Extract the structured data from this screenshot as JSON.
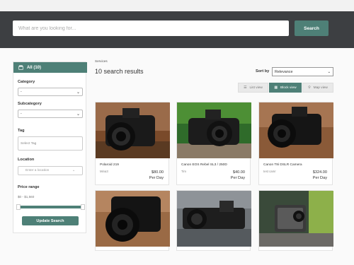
{
  "header": {
    "search_placeholder": "What are you looking for...",
    "search_label": "Search"
  },
  "sidebar": {
    "all_label": "All (10)",
    "category_label": "Category",
    "category_value": "-",
    "subcategory_label": "Subcategory",
    "subcategory_value": "-",
    "tag_label": "Tag",
    "tag_placeholder": "Select Tag",
    "location_label": "Location",
    "location_placeholder": "Enter a location",
    "price_label": "Price range",
    "price_value": "$0 - $1,560",
    "price_fill": 1.0,
    "update_label": "Update Search"
  },
  "main": {
    "breadcrumb": "Services",
    "results_title": "10 search results",
    "sort_label": "Sort by",
    "sort_value": "Relevance",
    "views": {
      "list": "List view",
      "block": "Block view",
      "map": "Map view",
      "active": "block"
    }
  },
  "listings": [
    {
      "title": "Polaroid 219",
      "sub": "Mina3",
      "price": "$80.00",
      "unit": "Per Day"
    },
    {
      "title": "Canon EOS Rebel SL3 / 250D",
      "sub": "Tim",
      "price": "$40.00",
      "unit": "Per Day"
    },
    {
      "title": "Canon T8i DSLR Camera",
      "sub": "test camr",
      "price": "$324.00",
      "unit": "Per Day"
    },
    {
      "title": "",
      "sub": "",
      "price": "",
      "unit": ""
    },
    {
      "title": "",
      "sub": "",
      "price": "",
      "unit": ""
    },
    {
      "title": "",
      "sub": "",
      "price": "",
      "unit": ""
    }
  ],
  "colors": {
    "accent": "#4e8077",
    "header_bg": "#3d3f42"
  }
}
